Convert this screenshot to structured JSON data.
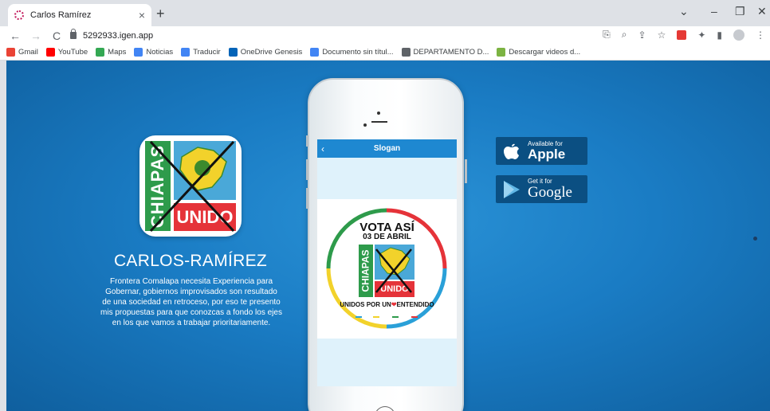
{
  "browser": {
    "tab": {
      "title": "Carlos Ramírez",
      "close": "×"
    },
    "new_tab": "+",
    "window": {
      "minimize": "–",
      "restore": "❐",
      "close": "✕",
      "tabsearch": "⌄"
    },
    "nav": {
      "back": "←",
      "forward": "→",
      "reload": "C"
    },
    "address": "5292933.igen.app",
    "bookmarks": [
      {
        "label": "Gmail",
        "color": "#ea4335"
      },
      {
        "label": "YouTube",
        "color": "#ff0000"
      },
      {
        "label": "Maps",
        "color": "#34a853"
      },
      {
        "label": "Noticias",
        "color": "#4285f4"
      },
      {
        "label": "Traducir",
        "color": "#4285f4"
      },
      {
        "label": "OneDrive Genesis",
        "color": "#0364b8"
      },
      {
        "label": "Documento sin títul...",
        "color": "#4285f4"
      },
      {
        "label": "DEPARTAMENTO D...",
        "color": "#5f6368"
      },
      {
        "label": "Descargar videos d...",
        "color": "#7cb342"
      }
    ]
  },
  "profile": {
    "logo_green_text": "CHIAPAS",
    "logo_red_text": "UNIDO",
    "name": "CARLOS-RAMÍREZ",
    "description": "Frontera Comalapa necesita Experiencia para Gobernar, gobiernos improvisados son resultado de una sociedad en retroceso, por eso te presento mis propuestas para que conozcas a fondo los ejes en los que vamos a trabajar prioritariamente."
  },
  "phone": {
    "back": "‹",
    "title": "Slogan",
    "slogan": {
      "vota": "VOTA ASÍ",
      "fecha": "03 DE ABRIL",
      "green_text": "CHIAPAS",
      "red_text": "UNIDO",
      "unidos_left": "UNIDOS POR UN",
      "heart": "❤",
      "unidos_right": "ENTENDIDO"
    }
  },
  "stores": {
    "apple": {
      "small": "Available for",
      "big": "Apple"
    },
    "google": {
      "small": "Get it for",
      "big": "Google"
    }
  }
}
